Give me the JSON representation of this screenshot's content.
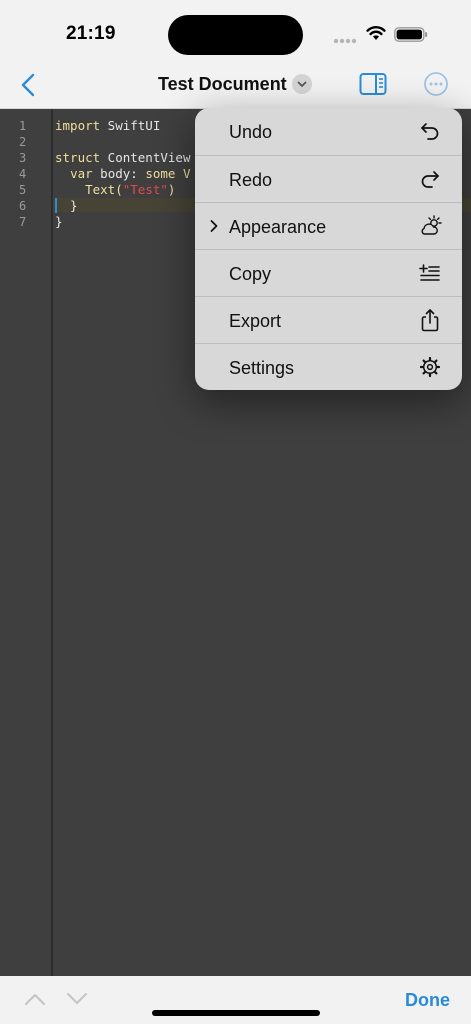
{
  "status_bar": {
    "time": "21:19"
  },
  "nav": {
    "title": "Test Document"
  },
  "editor": {
    "line_numbers": [
      "1",
      "2",
      "3",
      "4",
      "5",
      "6",
      "7"
    ],
    "lines": {
      "l1_kw": "import",
      "l1_rest": " SwiftUI",
      "l3_kw": "struct",
      "l3_rest": " ContentView",
      "l4_indent": "  ",
      "l4_kw1": "var",
      "l4_mid": " body: ",
      "l4_kw2": "some V",
      "l5_indent": "    ",
      "l5_fn": "Text(",
      "l5_str": "\"Test\"",
      "l5_end": ")",
      "l6": "  }",
      "l7": "}"
    }
  },
  "menu": {
    "items": [
      {
        "label": "Undo",
        "icon": "undo-icon"
      },
      {
        "label": "Redo",
        "icon": "redo-icon"
      },
      {
        "label": "Appearance",
        "icon": "cloud-sun-icon",
        "has_submenu": true
      },
      {
        "label": "Copy",
        "icon": "copy-text-icon"
      },
      {
        "label": "Export",
        "icon": "share-icon"
      },
      {
        "label": "Settings",
        "icon": "gear-icon"
      }
    ]
  },
  "bottom_bar": {
    "done_label": "Done"
  },
  "colors": {
    "accent": "#2a8bd6",
    "editor_bg": "#3f3f3f",
    "keyword": "#f0df9a",
    "string": "#e24a4a"
  }
}
